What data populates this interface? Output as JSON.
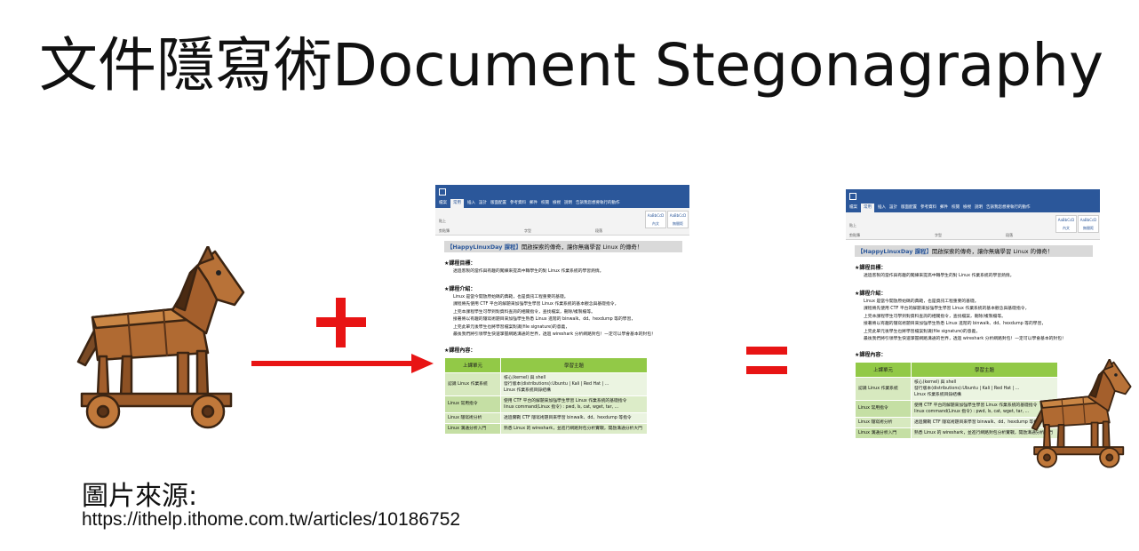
{
  "slide": {
    "title": "文件隱寫術Document Stegonagraphy",
    "source_label": "圖片來源:",
    "source_url": "https://ithelp.ithome.com.tw/articles/10186752"
  },
  "colors": {
    "operator_red": "#e81414",
    "ribbon_blue": "#2b579a",
    "table_header_green": "#92c947"
  },
  "icons": [
    "trojan-horse-icon",
    "plus-icon",
    "arrow-right-icon",
    "equals-icon"
  ],
  "document": {
    "tabs": [
      "檔案",
      "常用",
      "插入",
      "設計",
      "版面配置",
      "參考資料",
      "郵件",
      "校閱",
      "檢視",
      "說明",
      "告訴我您想要執行的動作"
    ],
    "active_tab": "常用",
    "toolbar": {
      "paste": "貼上",
      "clipboard": "剪貼簿",
      "font": "字型",
      "paragraph": "段落",
      "style1": "AaBbCcD",
      "style1_name": "內文",
      "style2": "AaBbCcD",
      "style2_name": "無間距"
    },
    "header_bold": "【HappyLinuxDay 課程】",
    "header_text": "開啟探索的傳奇，讓你無痛學習 Linux 的傳奇！",
    "goal_heading": "★課程目標：",
    "goal_text": "透過客製的當作與有趣的闖練來提高中職學生的對 Linux 作業系統的學習熱情。",
    "intro_heading": "★課程介紹：",
    "intro_lines": [
      "Linux 是當今開放原始碼的典範，也是資訊工程重要的基礎。",
      "課程將先使用 CTF 平台的解題來加強學生學習 Linux 作業系統的基本觀念與基礎指令，",
      "上完本課程學生可學到對資料查詢的相關指令，查找檔案，刪除/複製檔等。",
      "接著將以有趣的隱寫術題目來加強學生熟悉 Linux 進階的 binwalk、dd、hexdump 等的學習，",
      "上完此單元後學生也將學習檔案對識(file signature)的意義，",
      "最後我們將引領學生快速掌握網路溝通的世界，透過 wireshark 分析網路封包！一定可以學會基本的封包！"
    ],
    "content_heading": "★課程內容：",
    "table_headers": [
      "上課單元",
      "學習主題"
    ],
    "table_rows": [
      {
        "unit": "認識 Linux 作業系統",
        "topics": [
          "核心(kernel) 與 shell",
          "發行版本(distributions):Ubuntu | Kali | Red Hat | ...",
          "Linux 作業系統目錄結構"
        ]
      },
      {
        "unit": "Linux 常用指令",
        "topics": [
          "使用 CTF 平台的解題來加強學生學習 Linux 作業系統的基礎指令",
          "linux command(Linux 指令) : pwd, ls, cat, wget, tar, ..."
        ]
      },
      {
        "unit": "Linux 隱寫術分析",
        "topics": [
          "透過實戰 CTF 隱寫術題目來學習 binwalk、dd、hexdump 等指令"
        ]
      },
      {
        "unit": "Linux 溝通分析入門",
        "topics": [
          "熟悉 Linux 的 wireshark，並進行網路封包分析實戰，開啟溝通分析大門"
        ]
      }
    ]
  }
}
